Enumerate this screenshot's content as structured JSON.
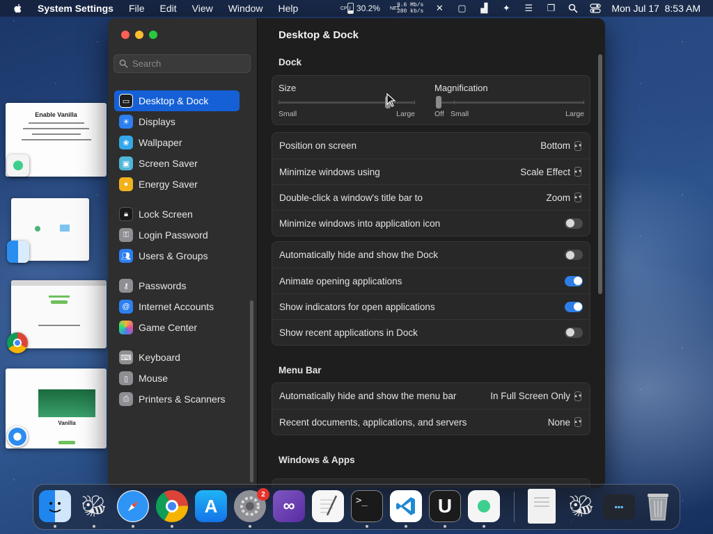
{
  "menubar": {
    "app_name": "System Settings",
    "items": [
      "File",
      "Edit",
      "View",
      "Window",
      "Help"
    ],
    "cpu_label": "CPU",
    "cpu_percent": "30.2%",
    "net_label": "NET",
    "net_down": "9.6 Mb/s",
    "net_up": "280 kb/s",
    "clock": "Mon Jul 17  8:53 AM"
  },
  "stage_manager": {
    "vanilla_window_title": "Enable Vanilla",
    "safari_window_title": "Vanilla"
  },
  "sidebar": {
    "search_placeholder": "Search",
    "items": [
      {
        "label": "Desktop & Dock",
        "icon": "desktop-dock-icon",
        "color": "#1e1e1e"
      },
      {
        "label": "Displays",
        "icon": "displays-icon",
        "color": "#2d7ff0"
      },
      {
        "label": "Wallpaper",
        "icon": "wallpaper-icon",
        "color": "#34a7e8"
      },
      {
        "label": "Screen Saver",
        "icon": "screen-saver-icon",
        "color": "#4fb6d8"
      },
      {
        "label": "Energy Saver",
        "icon": "energy-saver-icon",
        "color": "#f3b21b"
      },
      {
        "label": "Lock Screen",
        "icon": "lock-screen-icon",
        "color": "#1a1a1a"
      },
      {
        "label": "Login Password",
        "icon": "login-password-icon",
        "color": "#8e8e93"
      },
      {
        "label": "Users & Groups",
        "icon": "users-groups-icon",
        "color": "#2d7ff0"
      },
      {
        "label": "Passwords",
        "icon": "passwords-icon",
        "color": "#8e8e93"
      },
      {
        "label": "Internet Accounts",
        "icon": "internet-accounts-icon",
        "color": "#2d7ff0"
      },
      {
        "label": "Game Center",
        "icon": "game-center-icon",
        "color": "#e84b9a"
      },
      {
        "label": "Keyboard",
        "icon": "keyboard-icon",
        "color": "#8e8e93"
      },
      {
        "label": "Mouse",
        "icon": "mouse-icon",
        "color": "#8e8e93"
      },
      {
        "label": "Printers & Scanners",
        "icon": "printers-scanners-icon",
        "color": "#8e8e93"
      }
    ]
  },
  "content": {
    "title": "Desktop & Dock",
    "dock_section": "Dock",
    "size": {
      "label": "Size",
      "min_label": "Small",
      "max_label": "Large",
      "value_fraction": 0.8
    },
    "magnification": {
      "label": "Magnification",
      "off_label": "Off",
      "min_label": "Small",
      "max_label": "Large",
      "value_fraction": 0.0
    },
    "group1": [
      {
        "label": "Position on screen",
        "value": "Bottom"
      },
      {
        "label": "Minimize windows using",
        "value": "Scale Effect"
      },
      {
        "label": "Double-click a window's title bar to",
        "value": "Zoom"
      },
      {
        "label": "Minimize windows into application icon",
        "toggle": false
      }
    ],
    "group2": [
      {
        "label": "Automatically hide and show the Dock",
        "toggle": false
      },
      {
        "label": "Animate opening applications",
        "toggle": true
      },
      {
        "label": "Show indicators for open applications",
        "toggle": true
      },
      {
        "label": "Show recent applications in Dock",
        "toggle": false
      }
    ],
    "menubar_section": "Menu Bar",
    "group3": [
      {
        "label": "Automatically hide and show the menu bar",
        "value": "In Full Screen Only"
      },
      {
        "label": "Recent documents, applications, and servers",
        "value": "None"
      }
    ],
    "windows_section": "Windows & Apps"
  },
  "dock": {
    "system_settings_badge": "2",
    "apps": [
      "Finder",
      "Bee",
      "Safari",
      "Chrome",
      "App Store",
      "System Settings",
      "Visual Studio",
      "TextEdit",
      "Terminal",
      "VS Code",
      "Ubar",
      "Vanilla",
      "Preview",
      "Bee",
      "Windows",
      "Trash"
    ]
  },
  "colors": {
    "accent": "#1560d6",
    "toggle_on": "#2f7ee8",
    "close": "#ff5f57",
    "minimize": "#febc2e",
    "zoom": "#28c840"
  }
}
